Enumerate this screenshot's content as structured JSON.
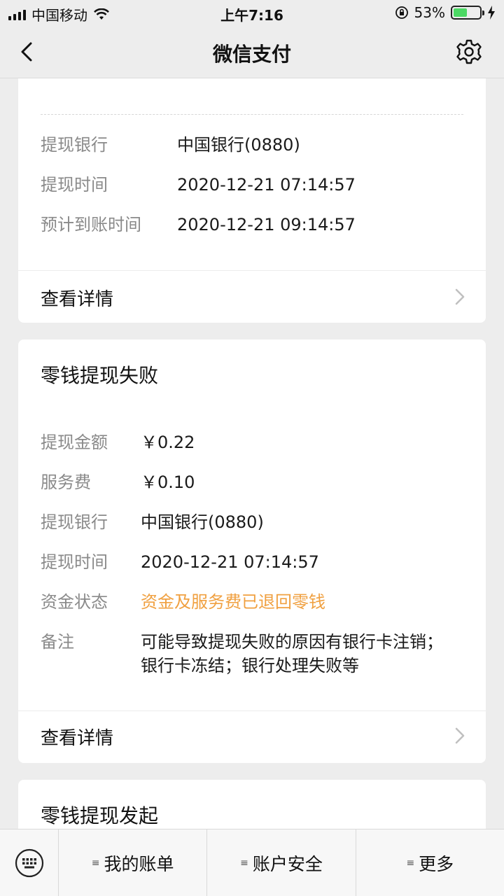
{
  "status_bar": {
    "carrier": "中国移动",
    "time": "上午7:16",
    "battery_percent": "53%",
    "battery_level": 0.53
  },
  "nav": {
    "title": "微信支付"
  },
  "card1": {
    "rows": [
      {
        "label": "提现银行",
        "value": "中国银行(0880)"
      },
      {
        "label": "提现时间",
        "value": "2020-12-21 07:14:57"
      },
      {
        "label": "预计到账时间",
        "value": "2020-12-21 09:14:57"
      }
    ],
    "detail_link": "查看详情"
  },
  "card2": {
    "title": "零钱提现失败",
    "rows": [
      {
        "label": "提现金额",
        "value": "￥0.22"
      },
      {
        "label": "服务费",
        "value": "￥0.10"
      },
      {
        "label": "提现银行",
        "value": "中国银行(0880)"
      },
      {
        "label": "提现时间",
        "value": "2020-12-21 07:14:57"
      },
      {
        "label": "资金状态",
        "value": "资金及服务费已退回零钱"
      },
      {
        "label": "备注",
        "value": "可能导致提现失败的原因有银行卡注销；银行卡冻结；银行处理失败等"
      }
    ],
    "detail_link": "查看详情"
  },
  "card3": {
    "title": "零钱提现发起"
  },
  "bottom_bar": {
    "items": [
      {
        "label": "我的账单"
      },
      {
        "label": "账户安全"
      },
      {
        "label": "更多"
      }
    ]
  },
  "colors": {
    "accent_orange": "#f0a040",
    "battery_green": "#4cd964",
    "background": "#ededed"
  },
  "icons": [
    "back-icon",
    "gear-icon",
    "chevron-right-icon",
    "keyboard-icon",
    "wifi-icon",
    "lock-rotation-icon",
    "charging-icon"
  ]
}
